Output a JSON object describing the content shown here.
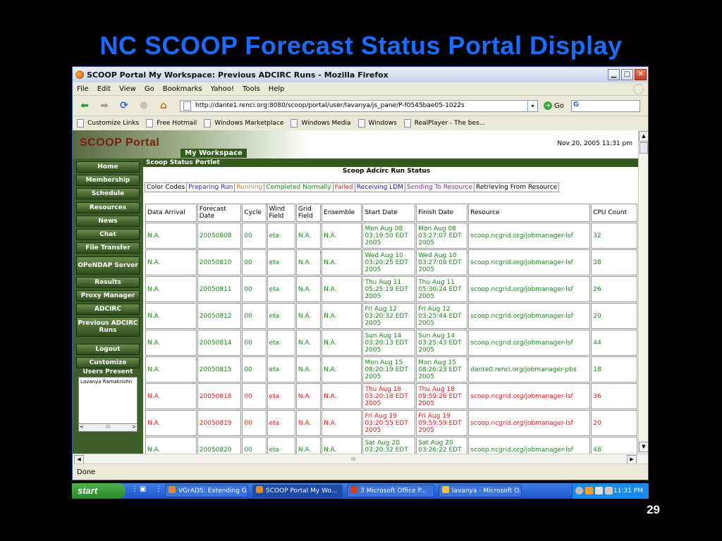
{
  "slide": {
    "title": "NC SCOOP Forecast Status Portal Display",
    "number": "29"
  },
  "window": {
    "title": "SCOOP Portal My Workspace: Previous ADCIRC Runs - Mozilla Firefox",
    "min_glyph": "▁",
    "max_glyph": "□",
    "close_glyph": "✕"
  },
  "menu": [
    "File",
    "Edit",
    "View",
    "Go",
    "Bookmarks",
    "Yahoo!",
    "Tools",
    "Help"
  ],
  "toolbar": {
    "url": "http://dante1.renci.org:8080/scoop/portal/user/lavanya/js_pane/P-f0545bae05-1022s",
    "go_label": "Go",
    "search_value": "G",
    "back_glyph": "⬅",
    "fwd_glyph": "➡",
    "reload_glyph": "⟳",
    "stop_glyph": "⊗",
    "home_glyph": "⌂",
    "dropdown_glyph": "▾"
  },
  "bookmarks": [
    "Customize Links",
    "Free Hotmail",
    "Windows Marketplace",
    "Windows Media",
    "Windows",
    "RealPlayer - The bes..."
  ],
  "portal": {
    "logo": "SCOOP Portal",
    "datetime": "Nov 20, 2005 11:31 pm",
    "tab": "My Workspace",
    "portlet_header": "Scoop Status Portlet",
    "portlet_title": "Scoop Adcirc Run Status",
    "color_codes": [
      {
        "label": "Color Codes",
        "color": "#000000"
      },
      {
        "label": "Preparing Run",
        "color": "#2a2acc"
      },
      {
        "label": "Running",
        "color": "#d08030"
      },
      {
        "label": "Completed Normally",
        "color": "#1a8a1a"
      },
      {
        "label": "Failed",
        "color": "#dd2020"
      },
      {
        "label": "Receiving LDM",
        "color": "#1a1aa0"
      },
      {
        "label": "Sending To Resource",
        "color": "#8a2a8a"
      },
      {
        "label": "Retrieving From Resource",
        "color": "#000000"
      }
    ]
  },
  "sidebar": {
    "items": [
      "Home",
      "Membership",
      "Schedule",
      "Resources",
      "News",
      "Chat",
      "File Transfer",
      "OPeNDAP Server",
      "Results",
      "Proxy Manager",
      "ADCIRC",
      "Previous ADCIRC Runs",
      "Logout",
      "Customize"
    ],
    "users_label": "Users Present",
    "users": [
      "Lavanya Ramakrishn"
    ],
    "scroll_left": "<",
    "scroll_mid": "III",
    "scroll_right": ">"
  },
  "table": {
    "headers": [
      "Data Arrival",
      "Forecast Date",
      "Cycle",
      "Wind Field",
      "Grid Field",
      "Ensemble",
      "Start Date",
      "Finish Date",
      "Resource",
      "CPU Count"
    ],
    "rows": [
      {
        "status": "ok",
        "cells": [
          "N.A.",
          "20050808",
          "00",
          "eta",
          "N.A.",
          "N.A.",
          "Mon Aug 08 03:19:50 EDT 2005",
          "Mon Aug 08 03:27:07 EDT 2005",
          "scoop.ncgrid.org/jobmanager-lsf",
          "32"
        ]
      },
      {
        "status": "ok",
        "cells": [
          "N.A.",
          "20050810",
          "00",
          "eta",
          "N.A.",
          "N.A.",
          "Wed Aug 10 03:20:25 EDT 2005",
          "Wed Aug 10 03:27:08 EDT 2005",
          "scoop.ncgrid.org/jobmanager-lsf",
          "38"
        ]
      },
      {
        "status": "ok",
        "cells": [
          "N.A.",
          "20050811",
          "00",
          "eta",
          "N.A.",
          "N.A.",
          "Thu Aug 11 05:25:19 EDT 2005",
          "Thu Aug 11 05:30:24 EDT 2005",
          "scoop.ncgrid.org/jobmanager-lsf",
          "26"
        ]
      },
      {
        "status": "ok",
        "cells": [
          "N.A.",
          "20050812",
          "00",
          "eta",
          "N.A.",
          "N.A.",
          "Fri Aug 12 03:20:32 EDT 2005",
          "Fri Aug 12 03:25:44 EDT 2005",
          "scoop.ncgrid.org/jobmanager-lsf",
          "20"
        ]
      },
      {
        "status": "ok",
        "cells": [
          "N.A.",
          "20050814",
          "00",
          "eta",
          "N.A.",
          "N.A.",
          "Sun Aug 14 03:20:13 EDT 2005",
          "Sun Aug 14 03:25:43 EDT 2005",
          "scoop.ncgrid.org/jobmanager-lsf",
          "44"
        ]
      },
      {
        "status": "ok",
        "cells": [
          "N.A.",
          "20050815",
          "00",
          "eta",
          "N.A.",
          "N.A.",
          "Mon Aug 15 08:20:19 EDT 2005",
          "Mon Aug 15 08:26:23 EDT 2005",
          "dante0.renci.org/jobmanager-pbs",
          "18"
        ]
      },
      {
        "status": "failed",
        "cells": [
          "N.A.",
          "20050818",
          "00",
          "eta",
          "N.A.",
          "N.A.",
          "Thu Aug 18 03:20:18 EDT 2005",
          "Thu Aug 18 09:59:26 EDT 2005",
          "scoop.ncgrid.org/jobmanager-lsf",
          "36"
        ]
      },
      {
        "status": "failed",
        "cells": [
          "N.A.",
          "20050819",
          "00",
          "eta",
          "N.A.",
          "N.A.",
          "Fri Aug 19 03:20:55 EDT 2005",
          "Fri Aug 19 09:59:59 EDT 2005",
          "scoop.ncgrid.org/jobmanager-lsf",
          "20"
        ]
      },
      {
        "status": "ok",
        "cells": [
          "N.A.",
          "20050820",
          "00",
          "eta",
          "N.A.",
          "N.A.",
          "Sat Aug 20 03:20:32 EDT 2005",
          "Sat Aug 20 03:26:22 EDT 2005",
          "scoop.ncgrid.org/jobmanager-lsf",
          "48"
        ]
      }
    ],
    "status_colors": {
      "ok": "#1a8a1a",
      "failed": "#dd2020"
    }
  },
  "status": "Done",
  "taskbar": {
    "start": "start",
    "items": [
      {
        "label": "VGrADS: Extending G...",
        "active": false
      },
      {
        "label": "SCOOP Portal My Wo...",
        "active": true
      },
      {
        "label": "3 Microsoft Office P...",
        "active": false
      },
      {
        "label": "lavanya - Microsoft O...",
        "active": false
      }
    ],
    "clock": "11:31 PM"
  }
}
